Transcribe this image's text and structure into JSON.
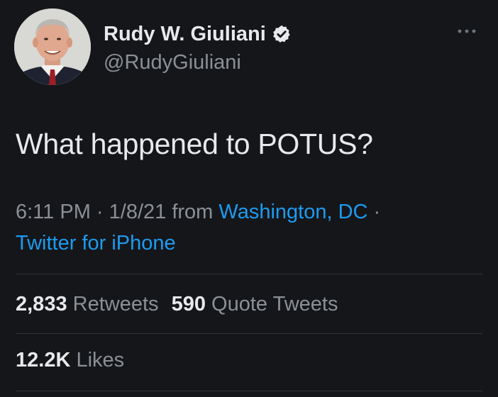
{
  "tweet": {
    "author": {
      "display_name": "Rudy W. Giuliani",
      "handle": "@RudyGiuliani",
      "verified": true,
      "avatar_icon": "profile-photo"
    },
    "text": "What happened to POTUS?",
    "meta": {
      "time": "6:11 PM",
      "separator_1": " · ",
      "date": "1/8/21",
      "from_label": " from ",
      "location": "Washington, DC",
      "separator_2": " · ",
      "source": "Twitter for iPhone"
    },
    "stats": {
      "retweets_count": "2,833",
      "retweets_label": "Retweets",
      "quotes_count": "590",
      "quotes_label": "Quote Tweets",
      "likes_count": "12.2K",
      "likes_label": "Likes"
    }
  },
  "colors": {
    "background": "#15161a",
    "primary_text": "#e7e9ea",
    "secondary_text": "#8b9096",
    "link": "#1d9bf0",
    "divider": "#2f3336"
  }
}
